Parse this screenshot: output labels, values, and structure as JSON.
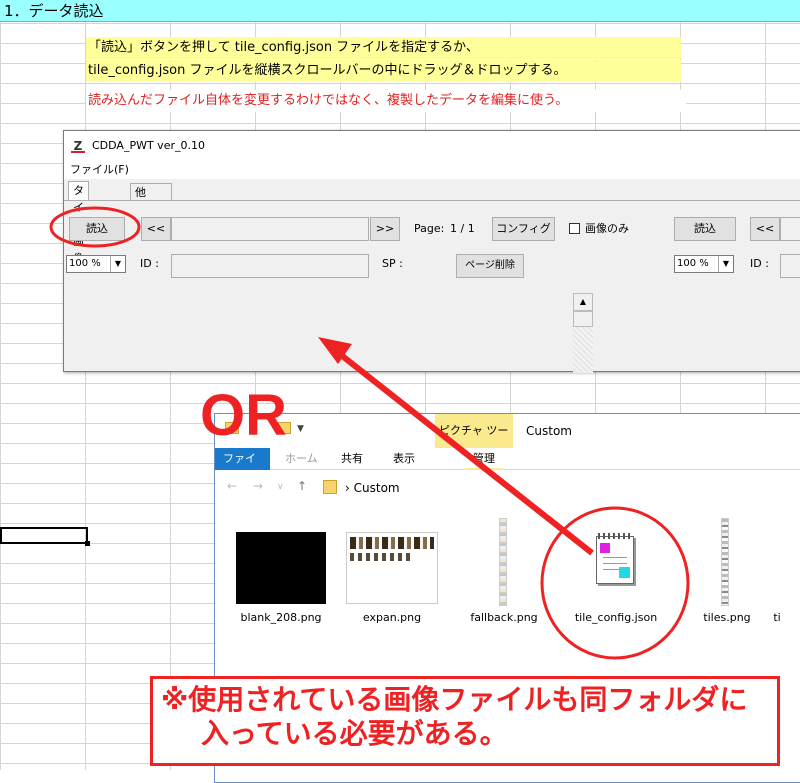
{
  "sheet": {
    "header": "1．データ読込",
    "note_line1": "「読込」ボタンを押して tile_config.json ファイルを指定するか、",
    "note_line2": "tile_config.json ファイルを縦横スクロールバーの中にドラッグ＆ドロップする。",
    "note_red": "読み込んだファイル自体を変更するわけではなく、複製したデータを編集に使う。"
  },
  "app": {
    "title": "CDDA_PWT ver_0.10",
    "menu_file": "ファイル(F)",
    "tabs": [
      "タイル画像",
      "他"
    ],
    "left": {
      "load_button": "読込",
      "prev_button": "<<",
      "next_button": ">>",
      "page_label": "Page:",
      "page_value": "1 /  1",
      "config_button": "コンフィグ",
      "image_only_label": "画像のみ",
      "zoom": "100 %",
      "id_label": "ID :",
      "sp_label": "SP :",
      "delete_page_button": "ページ削除"
    },
    "right": {
      "load_button": "読込",
      "prev_button": "<<",
      "zoom": "100 %",
      "id_label": "ID :"
    }
  },
  "explorer": {
    "context_tab": "ピクチャ ツール",
    "window_title": "Custom",
    "ribbon_tabs": [
      "ファイル",
      "ホーム",
      "共有",
      "表示",
      "管理"
    ],
    "breadcrumb": "Custom",
    "files": [
      {
        "name": "blank_208.png"
      },
      {
        "name": "expan.png"
      },
      {
        "name": "fallback.png"
      },
      {
        "name": "tile_config.json"
      },
      {
        "name": "tiles.png"
      },
      {
        "name": "ti"
      }
    ]
  },
  "annotation": {
    "or_text": "OR",
    "warning_line1": "※使用されている画像ファイルも同フォルダに",
    "warning_line2": "入っている必要がある。",
    "accent_color": "#ee2222"
  }
}
